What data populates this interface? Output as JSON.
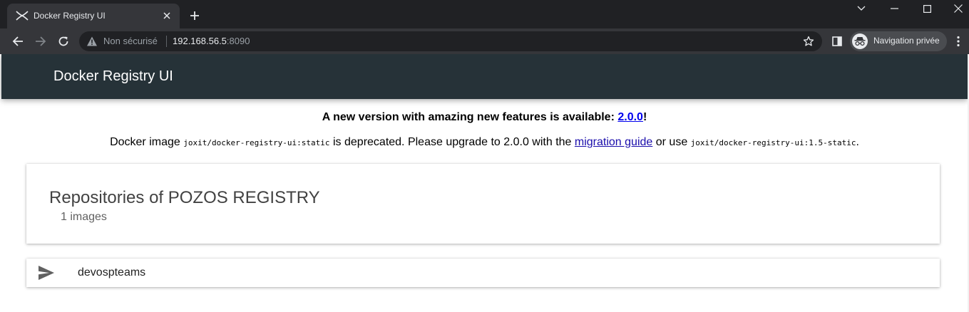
{
  "browser": {
    "tab": {
      "title": "Docker Registry UI"
    },
    "omnibox": {
      "security_label": "Non sécurisé",
      "host": "192.168.56.5",
      "port": ":8090"
    },
    "incognito_label": "Navigation privée"
  },
  "app": {
    "title": "Docker Registry UI",
    "notice": {
      "headline_prefix": "A new version with amazing new features is available: ",
      "headline_version": "2.0.0",
      "headline_suffix": "!",
      "text_prefix": "Docker image ",
      "deprecated_image": "joxit/docker-registry-ui:static",
      "text_middle": " is deprecated. Please upgrade to 2.0.0 with the ",
      "migration_link": "migration guide",
      "text_or": " or use ",
      "alternative_image": "joxit/docker-registry-ui:1.5-static",
      "text_end": "."
    },
    "repositories": {
      "title": "Repositories of POZOS REGISTRY",
      "count_label": "1 images",
      "items": [
        {
          "name": "devospteams",
          "icon": "send-icon"
        }
      ]
    }
  },
  "colors": {
    "chrome_dark": "#202124",
    "chrome_tab": "#35363a",
    "header_bg": "#263238",
    "link": "#1a0dab"
  }
}
